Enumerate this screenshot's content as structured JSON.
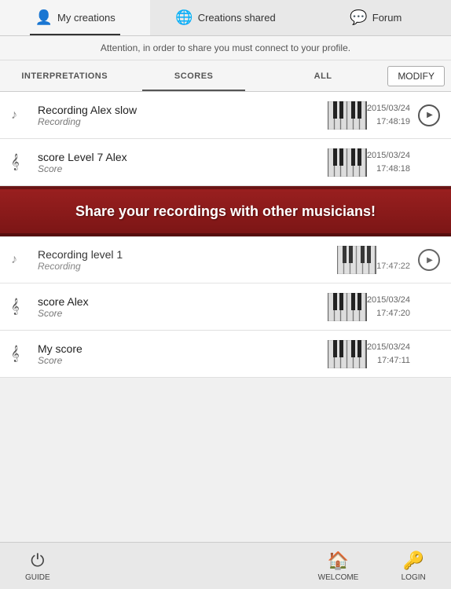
{
  "nav": {
    "tabs": [
      {
        "id": "my-creations",
        "label": "My creations",
        "icon": "👤",
        "active": true
      },
      {
        "id": "creations-shared",
        "label": "Creations shared",
        "icon": "🌐",
        "active": false
      },
      {
        "id": "forum",
        "label": "Forum",
        "icon": "💬",
        "active": false
      }
    ]
  },
  "attention": {
    "text": "Attention, in order to share you must connect to your profile."
  },
  "filters": {
    "tabs": [
      {
        "id": "interpretations",
        "label": "INTERPRETATIONS",
        "active": false
      },
      {
        "id": "scores",
        "label": "SCORES",
        "active": false
      },
      {
        "id": "all",
        "label": "ALL",
        "active": true
      }
    ],
    "modify_label": "MODIFY"
  },
  "items": [
    {
      "id": 1,
      "title": "Recording Alex slow",
      "subtitle": "Recording",
      "date": "2015/03/24",
      "time": "17:48:19",
      "has_play": true,
      "type": "recording"
    },
    {
      "id": 2,
      "title": "score Level 7 Alex",
      "subtitle": "Score",
      "date": "2015/03/24",
      "time": "17:48:18",
      "has_play": false,
      "type": "score"
    },
    {
      "id": 3,
      "title": "Recording level 1",
      "subtitle": "Recording",
      "date": "",
      "time": "17:47:22",
      "has_play": true,
      "type": "recording",
      "partial": true
    },
    {
      "id": 4,
      "title": "score Alex",
      "subtitle": "Score",
      "date": "2015/03/24",
      "time": "17:47:20",
      "has_play": false,
      "type": "score"
    },
    {
      "id": 5,
      "title": "My score",
      "subtitle": "Score",
      "date": "2015/03/24",
      "time": "17:47:11",
      "has_play": false,
      "type": "score"
    }
  ],
  "promo": {
    "text": "Share your recordings with other musicians!"
  },
  "bottom_nav": {
    "items": [
      {
        "id": "guide",
        "label": "GUIDE",
        "icon": "⏻"
      },
      {
        "id": "welcome",
        "label": "WELCOME",
        "icon": "🏠"
      },
      {
        "id": "login",
        "label": "LOGIN",
        "icon": "🔑"
      }
    ]
  }
}
